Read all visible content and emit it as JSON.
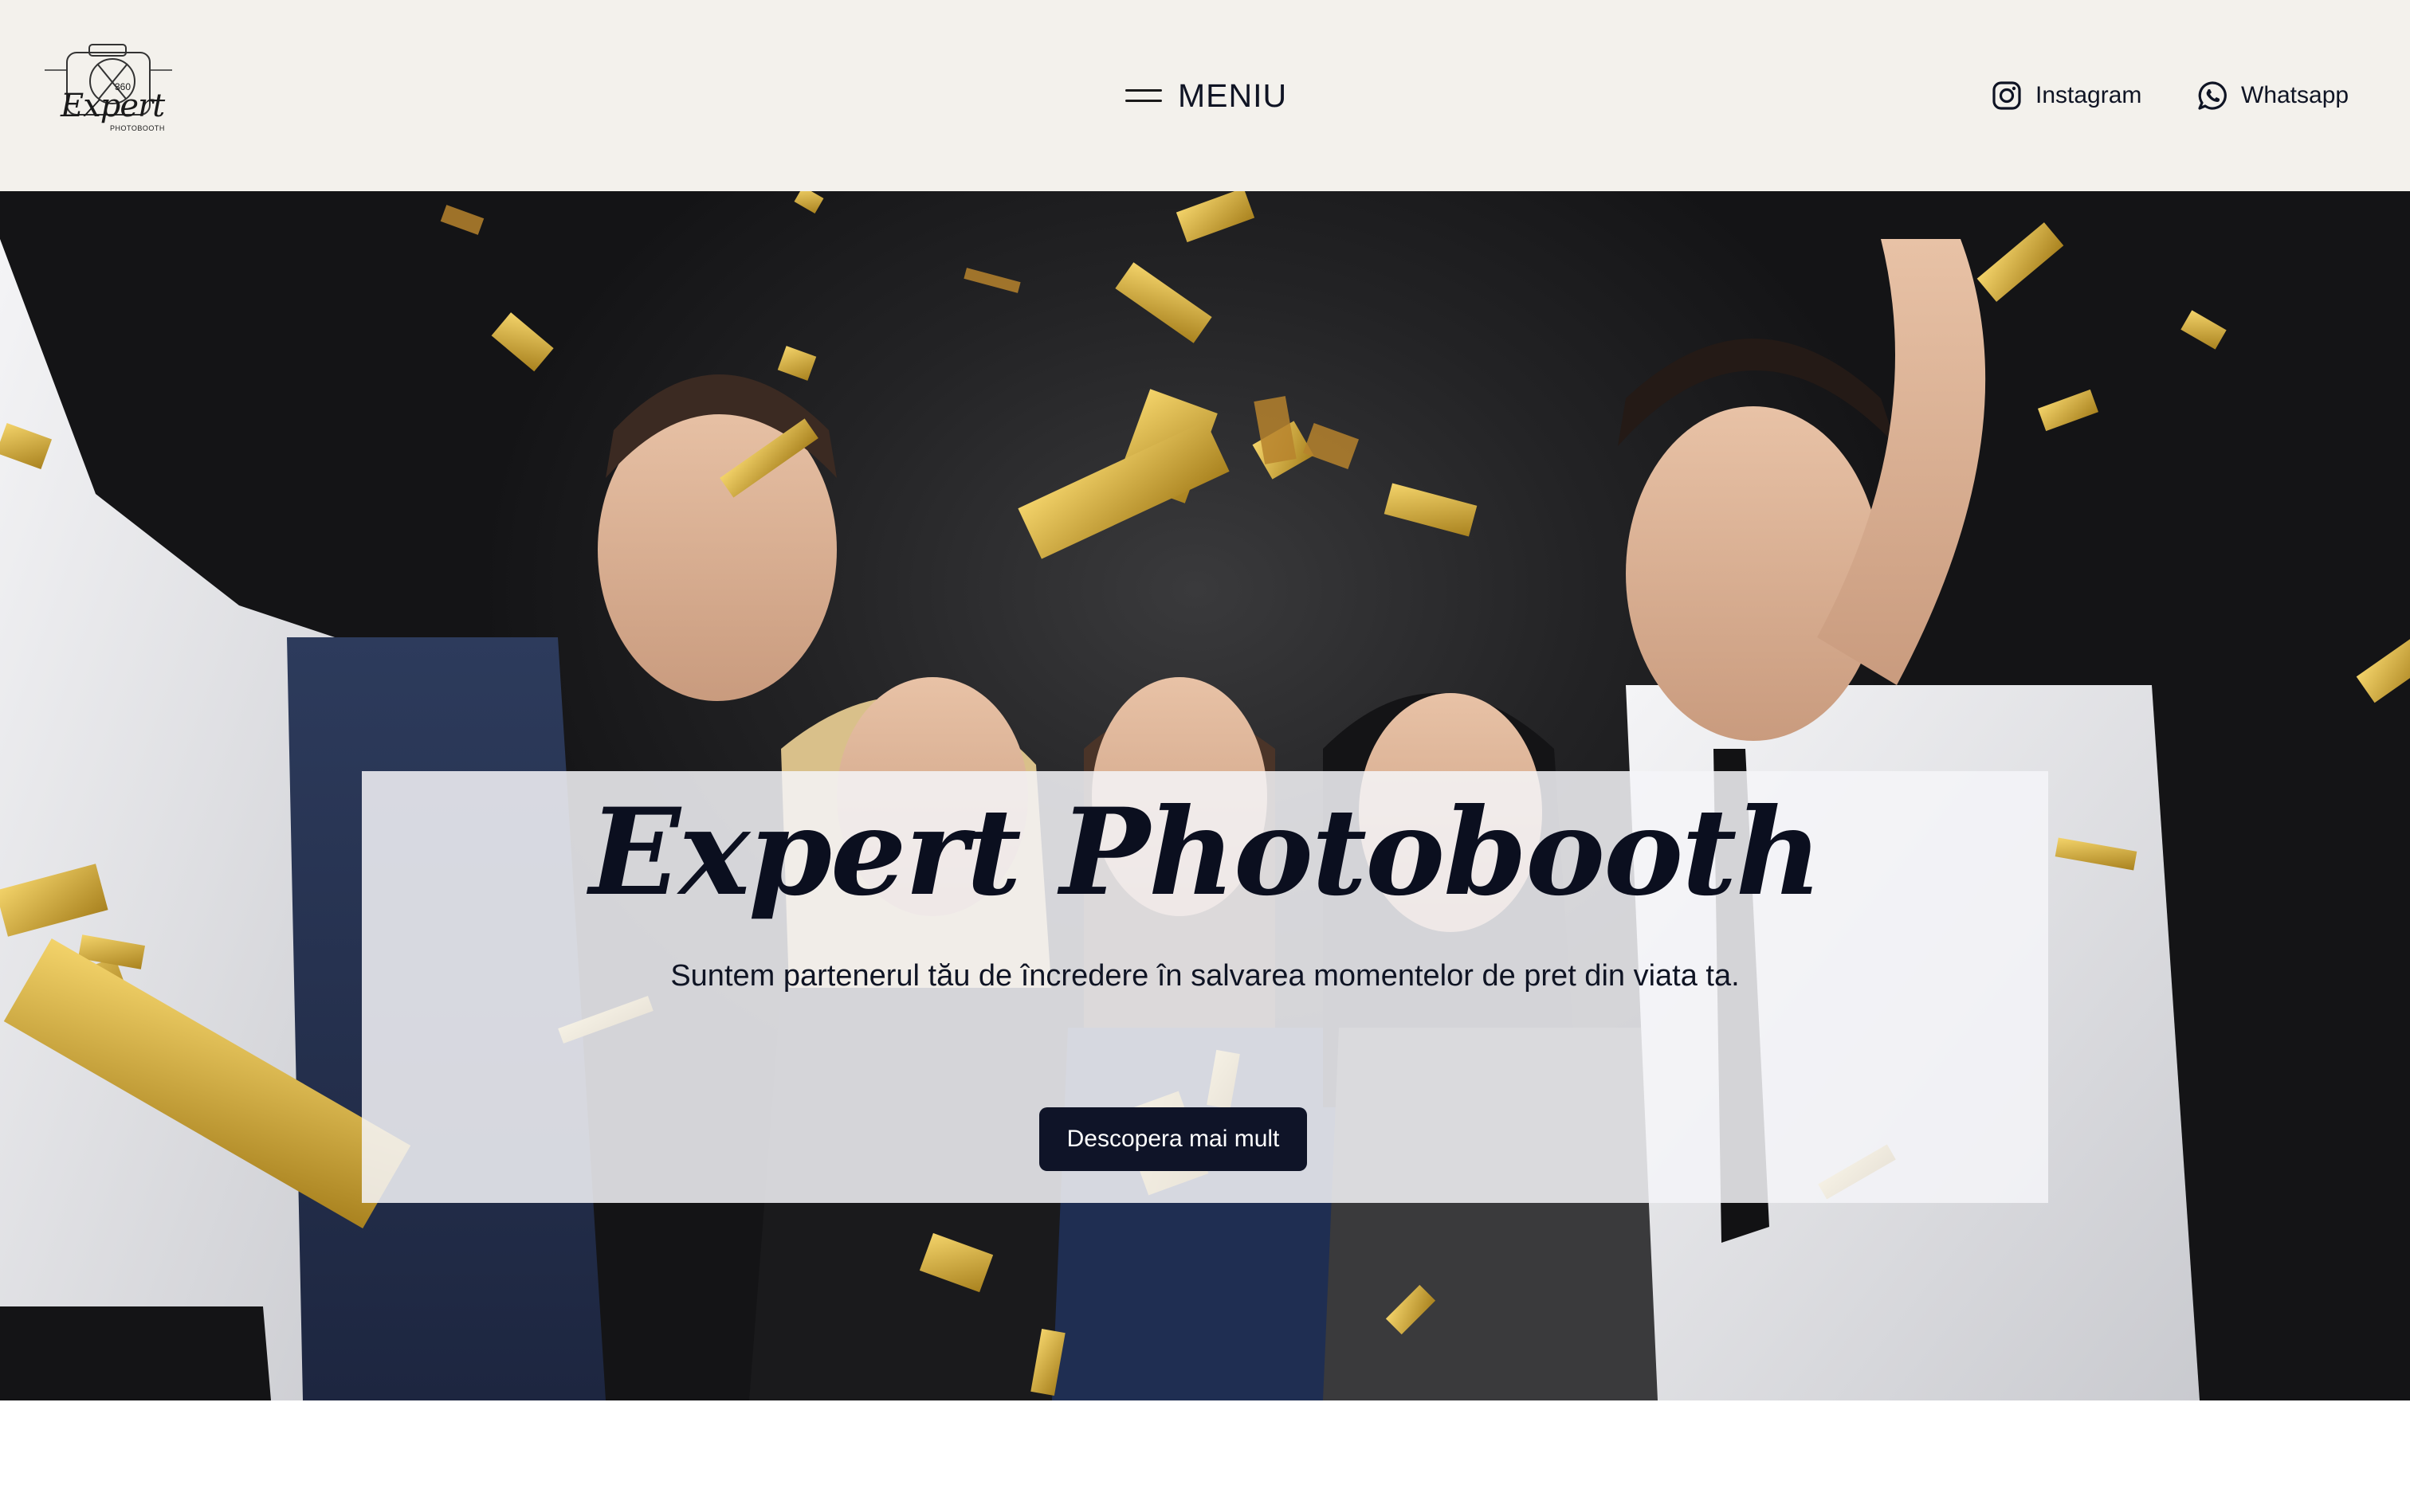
{
  "header": {
    "logo": {
      "brand": "Expert",
      "sub": "PHOTOBOOTH",
      "badge": "360",
      "icon": "camera-logo"
    },
    "menu": {
      "label": "MENIU",
      "icon": "hamburger-icon"
    },
    "social": [
      {
        "label": "Instagram",
        "icon": "instagram-icon"
      },
      {
        "label": "Whatsapp",
        "icon": "whatsapp-icon"
      }
    ]
  },
  "hero": {
    "title": "Expert Photobooth",
    "subtitle": "Suntem partenerul tău de încredere în salvarea momentelor de pret din viata ta.",
    "cta": "Descopera mai mult",
    "image": "party-group-confetti-photo",
    "colors": {
      "overlay": "#f5f5f8",
      "button": "#0f1428",
      "confetti": "#d4b23a"
    }
  }
}
